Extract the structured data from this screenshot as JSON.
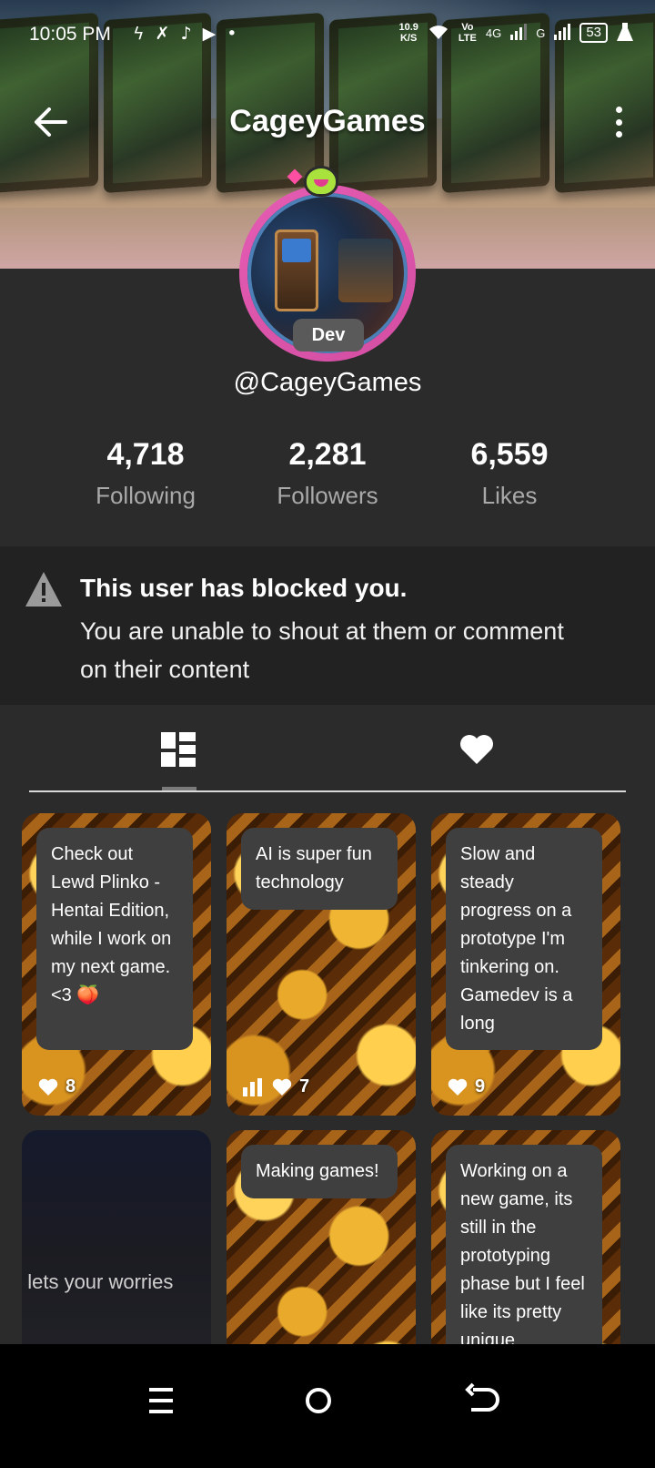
{
  "status_bar": {
    "time": "10:05 PM",
    "net_speed_value": "10.9",
    "net_speed_unit": "K/S",
    "volte_top": "Vo",
    "volte_bottom": "LTE",
    "network_4g": "4G",
    "network_g": "G",
    "battery": "53"
  },
  "header": {
    "title": "CageyGames",
    "badge": "Dev",
    "username": "@CageyGames"
  },
  "stats": [
    {
      "value": "4,718",
      "label": "Following"
    },
    {
      "value": "2,281",
      "label": "Followers"
    },
    {
      "value": "6,559",
      "label": "Likes"
    }
  ],
  "blocked_notice": {
    "title": "This user has blocked you.",
    "body": "You are unable to shout at them or comment on their content"
  },
  "tabs": [
    "posts-grid-icon",
    "likes-heart-icon"
  ],
  "posts": [
    {
      "text": "Check out Lewd Plinko - Hentai Edition, while I work on my next game. <3 🍑",
      "likes": "8"
    },
    {
      "text": "AI is super fun technology",
      "likes": "7"
    },
    {
      "text": "Slow and steady progress on a prototype I'm tinkering on. Gamedev is a long",
      "likes": "9"
    },
    {
      "text": "t lets your worries ",
      "likes": ""
    },
    {
      "text": "Making games!",
      "likes": ""
    },
    {
      "text": "Working on a new game, its still in the prototyping phase but I feel like its pretty unique",
      "likes": ""
    }
  ],
  "colors": {
    "background": "#2b2b2b",
    "notice_background": "#222222",
    "avatar_ring": "#e45cb3",
    "text_muted": "#a9a9a9"
  }
}
